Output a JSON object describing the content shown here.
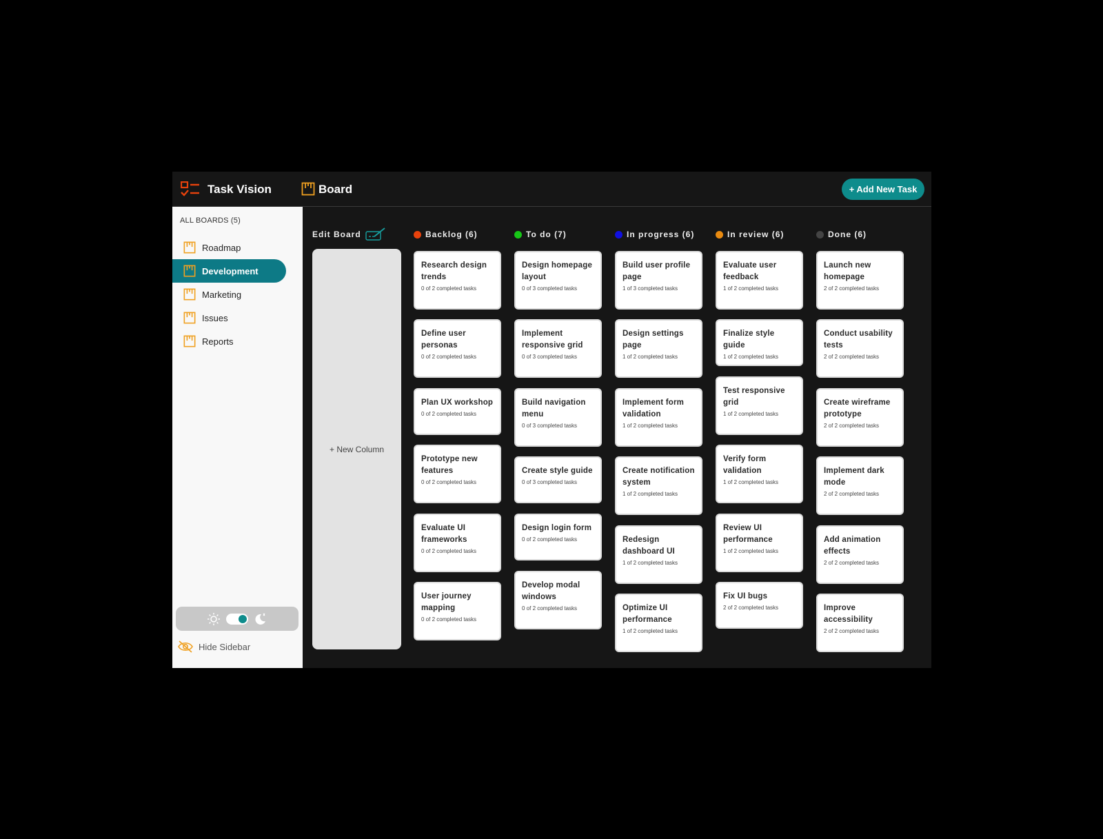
{
  "header": {
    "app_title": "Task Vision",
    "board_title": "Board",
    "add_task_label": "+ Add New Task"
  },
  "sidebar": {
    "all_boards_label": "ALL BOARDS (5)",
    "items": [
      {
        "label": "Roadmap",
        "active": false
      },
      {
        "label": "Development",
        "active": true
      },
      {
        "label": "Marketing",
        "active": false
      },
      {
        "label": "Issues",
        "active": false
      },
      {
        "label": "Reports",
        "active": false
      }
    ],
    "hide_label": "Hide Sidebar",
    "dark_mode": true
  },
  "board": {
    "edit_label": "Edit Board",
    "new_column_label": "+ New Column",
    "columns": [
      {
        "label": "Backlog (6)",
        "color": "#e8420c",
        "cards": [
          {
            "title": "Research design trends",
            "sub": "0 of 2 completed tasks"
          },
          {
            "title": "Define user personas",
            "sub": "0 of 2 completed tasks"
          },
          {
            "title": "Plan UX workshop",
            "sub": "0 of 2 completed tasks"
          },
          {
            "title": "Prototype new features",
            "sub": "0 of 2 completed tasks"
          },
          {
            "title": "Evaluate UI frameworks",
            "sub": "0 of 2 completed tasks"
          },
          {
            "title": "User journey mapping",
            "sub": "0 of 2 completed tasks"
          }
        ]
      },
      {
        "label": "To do (7)",
        "color": "#17c617",
        "cards": [
          {
            "title": "Design homepage layout",
            "sub": "0 of 3 completed tasks"
          },
          {
            "title": "Implement responsive grid",
            "sub": "0 of 3 completed tasks"
          },
          {
            "title": "Build navigation menu",
            "sub": "0 of 3 completed tasks"
          },
          {
            "title": "Create style guide",
            "sub": "0 of 3 completed tasks"
          },
          {
            "title": "Design login form",
            "sub": "0 of 2 completed tasks"
          },
          {
            "title": "Develop modal windows",
            "sub": "0 of 2 completed tasks"
          }
        ]
      },
      {
        "label": "In progress (6)",
        "color": "#1010e0",
        "cards": [
          {
            "title": "Build user profile page",
            "sub": "1 of 3 completed tasks"
          },
          {
            "title": "Design settings page",
            "sub": "1 of 2 completed tasks"
          },
          {
            "title": "Implement form validation",
            "sub": "1 of 2 completed tasks"
          },
          {
            "title": "Create notification system",
            "sub": "1 of 2 completed tasks"
          },
          {
            "title": "Redesign dashboard UI",
            "sub": "1 of 2 completed tasks"
          },
          {
            "title": "Optimize UI performance",
            "sub": "1 of 2 completed tasks"
          }
        ]
      },
      {
        "label": "In review (6)",
        "color": "#e88a10",
        "cards": [
          {
            "title": "Evaluate user feedback",
            "sub": "1 of 2 completed tasks"
          },
          {
            "title": "Finalize style guide",
            "sub": "1 of 2 completed tasks"
          },
          {
            "title": "Test responsive grid",
            "sub": "1 of 2 completed tasks"
          },
          {
            "title": "Verify form validation",
            "sub": "1 of 2 completed tasks"
          },
          {
            "title": "Review UI performance",
            "sub": "1 of 2 completed tasks"
          },
          {
            "title": "Fix UI bugs",
            "sub": "2 of 2 completed tasks"
          }
        ]
      },
      {
        "label": "Done (6)",
        "color": "#444444",
        "cards": [
          {
            "title": "Launch new homepage",
            "sub": "2 of 2 completed tasks"
          },
          {
            "title": "Conduct usability tests",
            "sub": "2 of 2 completed tasks"
          },
          {
            "title": "Create wireframe prototype",
            "sub": "2 of 2 completed tasks"
          },
          {
            "title": "Implement dark mode",
            "sub": "2 of 2 completed tasks"
          },
          {
            "title": "Add animation effects",
            "sub": "2 of 2 completed tasks"
          },
          {
            "title": "Improve accessibility",
            "sub": "2 of 2 completed tasks"
          }
        ]
      }
    ]
  }
}
